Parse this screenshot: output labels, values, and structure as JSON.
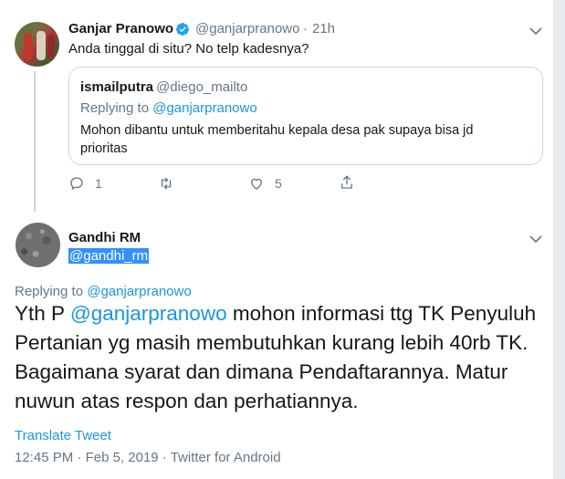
{
  "tweet1": {
    "author_name": "Ganjar Pranowo",
    "author_handle": "@ganjarpranowo",
    "separator": "·",
    "time": "21h",
    "text": "Anda tinggal di situ? No telp kadesnya?",
    "quote": {
      "author_name": "ismailputra",
      "author_handle": "@diego_mailto",
      "replying_prefix": "Replying to",
      "replying_to": "@ganjarpranowo",
      "text": "Mohon dibantu untuk memberitahu kepala desa pak supaya bisa jd prioritas"
    },
    "actions": {
      "reply_count": "1",
      "retweet_count": "",
      "like_count": "5"
    }
  },
  "tweet2": {
    "author_name": "Gandhi RM",
    "author_handle": "@gandhi_rm",
    "replying_prefix": "Replying to",
    "replying_to": "@ganjarpranowo",
    "text_before": "Yth P ",
    "mention": "@ganjarpranowo",
    "text_after": " mohon informasi ttg TK Penyuluh Pertanian yg masih membutuhkan kurang lebih 40rb TK. Bagaimana syarat dan dimana Pendaftarannya. Matur nuwun atas respon dan perhatiannya.",
    "translate_label": "Translate Tweet",
    "time": "12:45 PM",
    "date": "Feb 5, 2019",
    "source": "Twitter for Android",
    "meta_sep": " · "
  },
  "colors": {
    "link": "#1b95e0",
    "muted": "#657786",
    "text": "#14171a",
    "border": "#ccd6dd",
    "selection": "#3390ff"
  },
  "icons": [
    "verified-icon",
    "chevron-down-icon",
    "reply-icon",
    "retweet-icon",
    "like-icon",
    "share-icon"
  ]
}
